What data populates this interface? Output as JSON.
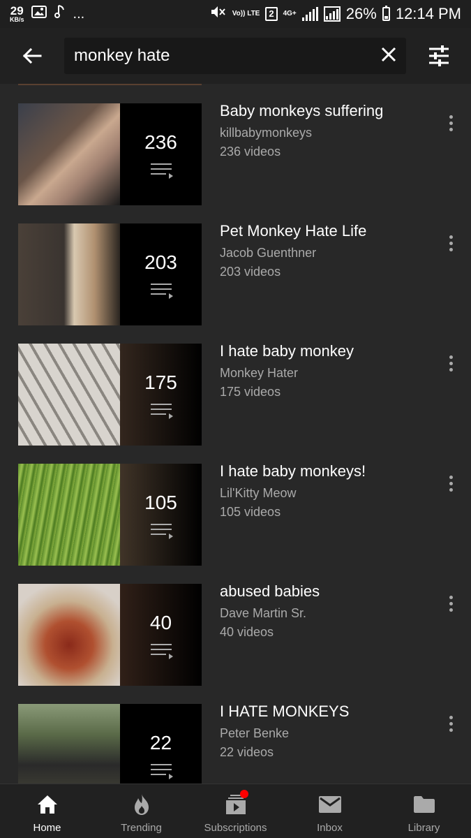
{
  "status_bar": {
    "speed_value": "29",
    "speed_unit": "KB/s",
    "more": "...",
    "volte": "Vo)) LTE",
    "sim": "2",
    "network": "4G+",
    "battery": "26%",
    "time": "12:14 PM"
  },
  "search": {
    "query": "monkey hate"
  },
  "results": [
    {
      "title": "Baby monkeys suffering",
      "channel": "killbabymonkeys",
      "count": "236",
      "videos": "236 videos",
      "thumb_colors": [
        "#3a3f4a",
        "#c9a88f",
        "#1a1a1a"
      ]
    },
    {
      "title": "Pet Monkey Hate Life",
      "channel": "Jacob Guenthner",
      "count": "203",
      "videos": "203 videos",
      "thumb_colors": [
        "#4a4038",
        "#d8c8b0",
        "#2a2520"
      ]
    },
    {
      "title": "I hate baby monkey",
      "channel": "Monkey Hater",
      "count": "175",
      "videos": "175 videos",
      "thumb_colors": [
        "#b8b4ae",
        "#6a5a48",
        "#8a8680"
      ]
    },
    {
      "title": "I hate baby monkeys!",
      "channel": "Lil'Kitty Meow",
      "count": "105",
      "videos": "105 videos",
      "thumb_colors": [
        "#5a8a2a",
        "#9ac050",
        "#7a6a50"
      ]
    },
    {
      "title": "abused babies",
      "channel": "Dave Martin Sr.",
      "count": "40",
      "videos": "40 videos",
      "thumb_colors": [
        "#d8d0c8",
        "#8a2a1a",
        "#c8b090"
      ]
    },
    {
      "title": "I HATE MONKEYS",
      "channel": "Peter Benke",
      "count": "22",
      "videos": "22 videos",
      "thumb_colors": [
        "#5a6a48",
        "#2a2a2a",
        "#8a9a78"
      ]
    }
  ],
  "nav": [
    {
      "label": "Home",
      "icon": "home-icon",
      "active": true
    },
    {
      "label": "Trending",
      "icon": "flame-icon",
      "active": false
    },
    {
      "label": "Subscriptions",
      "icon": "subscriptions-icon",
      "active": false
    },
    {
      "label": "Inbox",
      "icon": "mail-icon",
      "active": false
    },
    {
      "label": "Library",
      "icon": "folder-icon",
      "active": false
    }
  ],
  "colors": {
    "background": "#282828",
    "app_bar": "#212121",
    "text_secondary": "#aaaaaa",
    "notification_dot": "#ff0000"
  }
}
